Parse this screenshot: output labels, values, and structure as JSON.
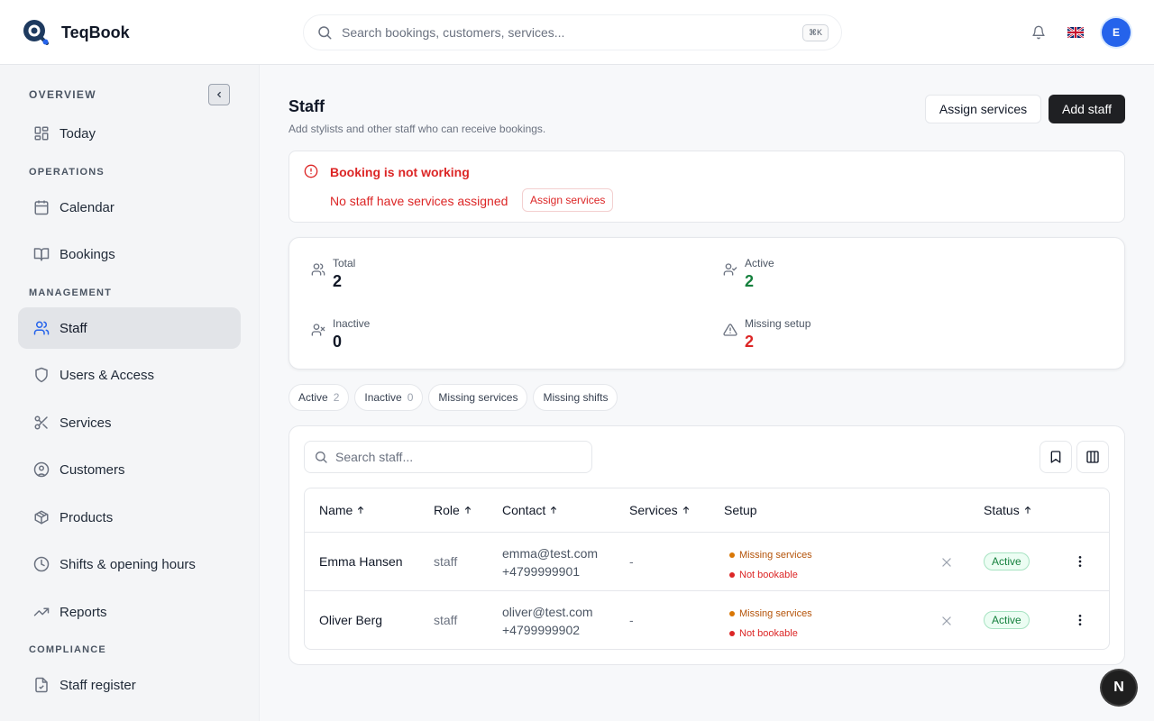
{
  "app": {
    "name": "TeqBook"
  },
  "search": {
    "placeholder": "Search bookings, customers, services...",
    "shortcut": "⌘K"
  },
  "topbar": {
    "notifications_icon": "bell-icon",
    "language_flag": "uk-flag",
    "avatar_initial": "E"
  },
  "sidebar": {
    "sections": {
      "overview": "OVERVIEW",
      "operations": "OPERATIONS",
      "management": "MANAGEMENT",
      "compliance": "COMPLIANCE"
    },
    "items": [
      {
        "label": "Today",
        "icon": "dashboard-grid-icon"
      },
      {
        "label": "Calendar",
        "icon": "calendar-icon"
      },
      {
        "label": "Bookings",
        "icon": "book-icon"
      },
      {
        "label": "Staff",
        "icon": "users-icon",
        "active": true
      },
      {
        "label": "Users & Access",
        "icon": "shield-icon"
      },
      {
        "label": "Services",
        "icon": "scissors-icon"
      },
      {
        "label": "Customers",
        "icon": "user-circle-icon"
      },
      {
        "label": "Products",
        "icon": "package-icon"
      },
      {
        "label": "Shifts & opening hours",
        "icon": "clock-icon"
      },
      {
        "label": "Reports",
        "icon": "trending-up-icon"
      },
      {
        "label": "Staff register",
        "icon": "file-check-icon"
      }
    ]
  },
  "page": {
    "title": "Staff",
    "subtitle": "Add stylists and other staff who can receive bookings.",
    "assign_services_label": "Assign services",
    "add_staff_label": "Add staff"
  },
  "alert": {
    "title": "Booking is not working",
    "message": "No staff have services assigned",
    "action_label": "Assign services"
  },
  "stats": {
    "total": {
      "label": "Total",
      "value": "2"
    },
    "active": {
      "label": "Active",
      "value": "2"
    },
    "inactive": {
      "label": "Inactive",
      "value": "0"
    },
    "missing_setup": {
      "label": "Missing setup",
      "value": "2"
    }
  },
  "filters": [
    {
      "label": "Active",
      "count": "2"
    },
    {
      "label": "Inactive",
      "count": "0"
    },
    {
      "label": "Missing services",
      "count": ""
    },
    {
      "label": "Missing shifts",
      "count": ""
    }
  ],
  "table": {
    "search_placeholder": "Search staff...",
    "columns": {
      "name": "Name",
      "role": "Role",
      "contact": "Contact",
      "services": "Services",
      "setup": "Setup",
      "status": "Status"
    },
    "rows": [
      {
        "name": "Emma Hansen",
        "role": "staff",
        "email": "emma@test.com",
        "phone": "+4799999901",
        "services": "-",
        "setup_1": "Missing services",
        "setup_2": "Not bookable",
        "status": "Active"
      },
      {
        "name": "Oliver Berg",
        "role": "staff",
        "email": "oliver@test.com",
        "phone": "+4799999902",
        "services": "-",
        "setup_1": "Missing services",
        "setup_2": "Not bookable",
        "status": "Active"
      }
    ]
  },
  "floating": {
    "label": "N"
  },
  "colors": {
    "accent": "#2563eb",
    "danger": "#dc2626",
    "success": "#15803d",
    "warning": "#b45309",
    "dark_button": "#1f2023"
  }
}
